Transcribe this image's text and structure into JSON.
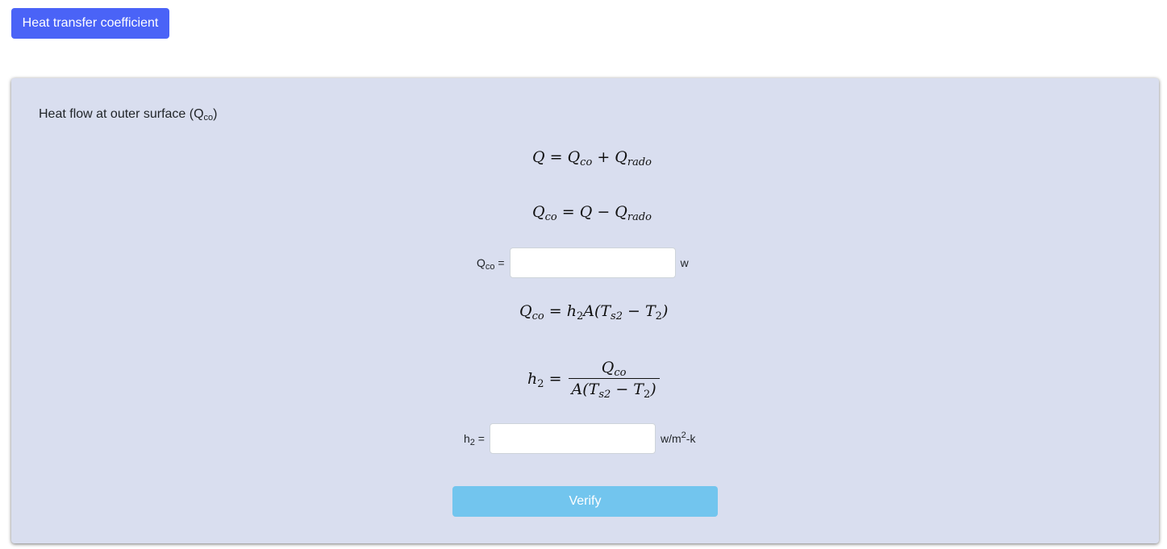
{
  "header": {
    "tab_label": "Heat transfer coefficient"
  },
  "panel": {
    "heading_text": "Heat flow at outer surface (Q",
    "heading_sub": "co",
    "heading_close": ")",
    "field1": {
      "label_main": "Q",
      "label_sub": "co",
      "label_eq": " =",
      "value": "",
      "unit": "w"
    },
    "field2": {
      "label_main": "h",
      "label_sub": "2",
      "label_eq": " =",
      "value": "",
      "unit_main": "w/m",
      "unit_sup": "2",
      "unit_rest": "-k"
    },
    "verify_label": "Verify"
  },
  "colors": {
    "tab_button": "#4a63f7",
    "panel_bg": "#d9deef",
    "verify_button": "#72c5ee"
  }
}
